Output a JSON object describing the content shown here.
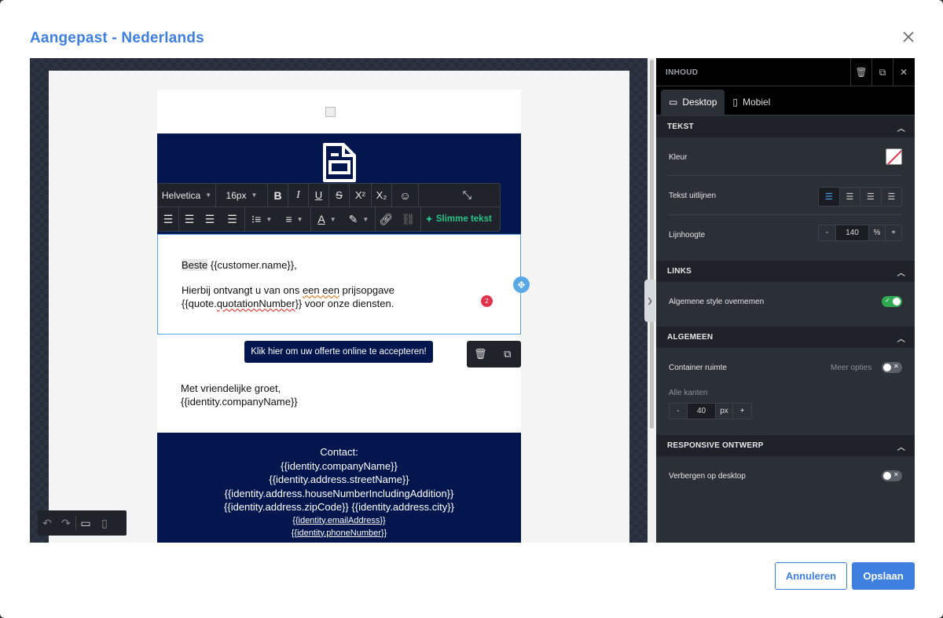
{
  "modal": {
    "title": "Aangepast - Nederlands"
  },
  "editor": {
    "toolbar": {
      "font": "Helvetica",
      "size": "16px",
      "bold": "B",
      "italic": "I",
      "underline": "U",
      "strike": "S",
      "superscript": "X²",
      "subscript": "X₂",
      "smart_text": "Slimme tekst"
    },
    "text_block": {
      "greeting_word": "Beste",
      "greeting_rest": " {{customer.name}},",
      "line2_a": "Hierbij ontvangt u van ons ",
      "line2_b": "een een",
      "line2_c": " prijsopgave",
      "line3_a": "{{quote.",
      "line3_b": "quotationNumber",
      "line3_c": "}} voor onze diensten."
    },
    "badge": "2",
    "cta": "Klik hier om uw offerte online te accepteren!",
    "closing": [
      "Met vriendelijke groet,",
      "{{identity.companyName}}"
    ],
    "footer": {
      "lines": [
        "Contact:",
        "{{identity.companyName}}",
        "{{identity.address.streetName}}",
        "{{identity.address.houseNumberIncludingAddition}}",
        "{{identity.address.zipCode}} {{identity.address.city}}"
      ],
      "small": [
        "{{identity.emailAddress}}",
        "{{identity.phoneNumber}}"
      ]
    }
  },
  "panel": {
    "header": "INHOUD",
    "tabs": [
      "Desktop",
      "Mobiel"
    ],
    "sections": {
      "text": {
        "title": "TEKST",
        "color_label": "Kleur",
        "align_label": "Tekst uitlijnen",
        "lineheight_label": "Lijnhoogte",
        "lineheight_value": "140",
        "lineheight_unit": "%"
      },
      "links": {
        "title": "LINKS",
        "inherit_label": "Algemene style overnemen",
        "inherit_on": true
      },
      "general": {
        "title": "ALGEMEEN",
        "padding_label": "Container ruimte",
        "more_options": "Meer opties",
        "all_sides": "Alle kanten",
        "padding_value": "40",
        "padding_unit": "px"
      },
      "responsive": {
        "title": "RESPONSIVE ONTWERP",
        "hide_desktop_label": "Verbergen op desktop"
      }
    },
    "stepper": {
      "minus": "-",
      "plus": "+"
    }
  },
  "buttons": {
    "cancel": "Annuleren",
    "save": "Opslaan"
  },
  "colors": {
    "accent": "#3f7fe0",
    "email_navy": "#03164d",
    "panel_bg": "#2b2f36",
    "toggle_on": "#2fa84f",
    "smart": "#27c28c"
  }
}
